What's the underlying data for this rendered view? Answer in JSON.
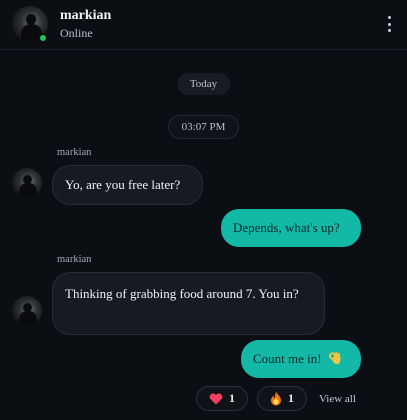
{
  "header": {
    "contact_name": "markian",
    "status": "Online"
  },
  "chips": {
    "day": "Today",
    "time": "03:07 PM"
  },
  "messages": [
    {
      "direction": "incoming",
      "sender": "markian",
      "text": "Yo, are you free later?"
    },
    {
      "direction": "outgoing",
      "text": "Depends, what's up?"
    },
    {
      "direction": "incoming",
      "sender": "markian",
      "text": "Thinking of grabbing food around 7. You in?"
    },
    {
      "direction": "outgoing",
      "text": "Count me in!",
      "emoji_icon": "ok-hand-icon"
    }
  ],
  "reactions": [
    {
      "icon": "heart-icon",
      "count": "1"
    },
    {
      "icon": "fire-icon",
      "count": "1"
    }
  ],
  "view_all_label": "View all",
  "colors": {
    "background": "#0b0f14",
    "accent": "#14b8a6",
    "online": "#22c55e",
    "incoming_bubble": "#161b22"
  }
}
